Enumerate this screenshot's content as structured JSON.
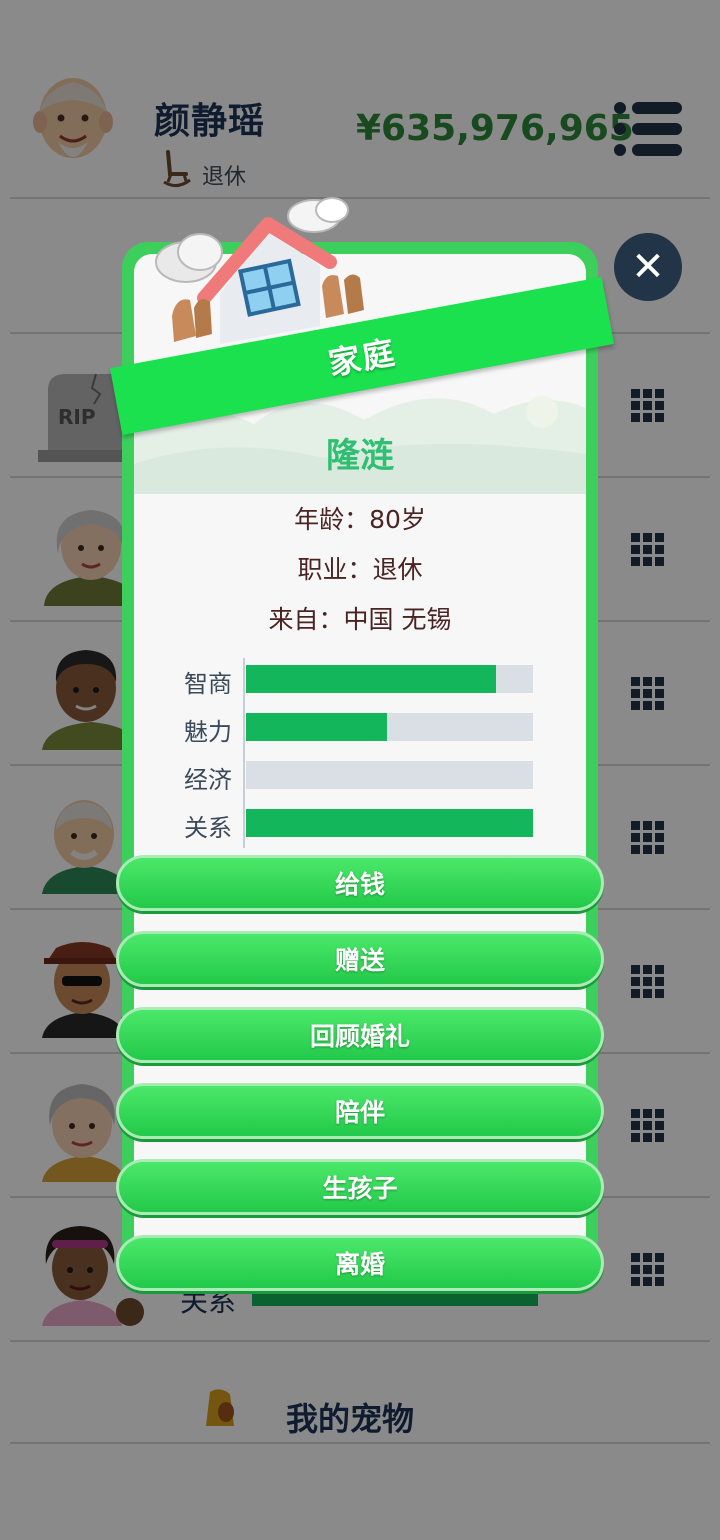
{
  "header": {
    "player_name": "颜静瑶",
    "job": "退休",
    "money": "¥635,976,965"
  },
  "background": {
    "rip_text": "RIP",
    "partial_stat_label": "关系",
    "pet_label": "我的宠物"
  },
  "modal": {
    "title": "家庭",
    "person_name": "隆涟",
    "age_line": "年龄：80岁",
    "job_line": "职业：退休",
    "origin_line": "来自：中国 无锡",
    "stats": [
      {
        "label": "智商",
        "level": 0.87
      },
      {
        "label": "魅力",
        "level": 0.49
      },
      {
        "label": "经济",
        "level": 0.0
      },
      {
        "label": "关系",
        "level": 1.0
      }
    ],
    "actions": [
      "给钱",
      "赠送",
      "回顾婚礼",
      "陪伴",
      "生孩子",
      "离婚"
    ]
  },
  "colors": {
    "frame_green": "#3dcf5c",
    "ribbon_green": "#1be14e",
    "stat_fill": "#14b65b",
    "name_green": "#2fbf72",
    "money_green": "#2f8a3a",
    "navy": "#1d3557"
  },
  "icons": {
    "close": "close-icon",
    "menu": "menu-icon",
    "grid": "grid-icon",
    "retire": "rocking-chair-icon",
    "house": "house-icon",
    "pet": "dog-icon"
  }
}
